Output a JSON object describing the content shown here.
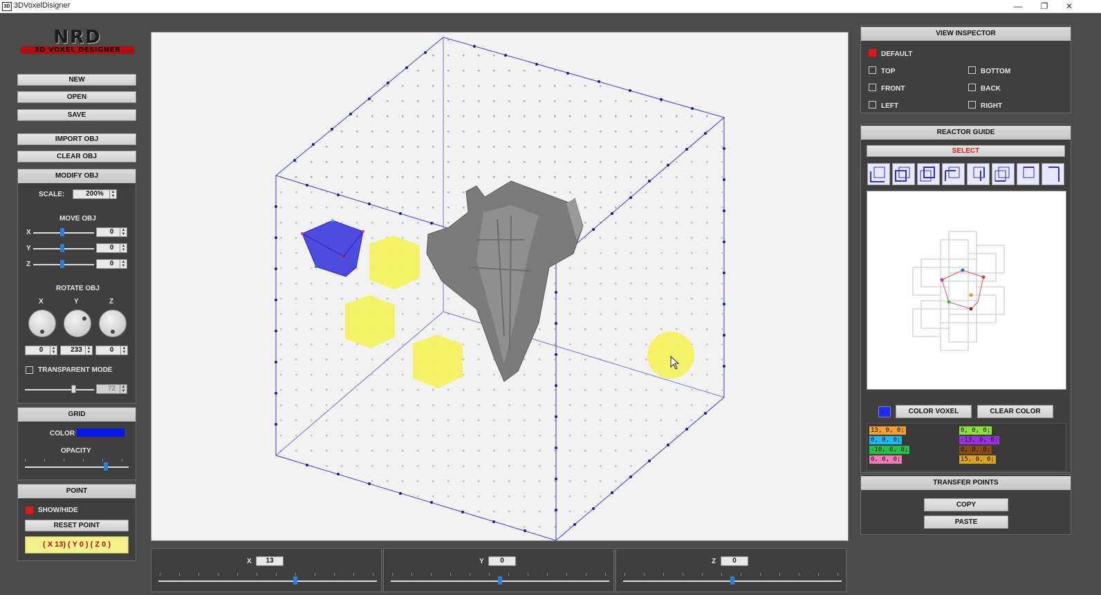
{
  "window": {
    "title": "3DVoxelDisigner",
    "minimize": "—",
    "restore": "❐",
    "close": "✕",
    "app_icon": "3D"
  },
  "logo": {
    "line1": "NRD",
    "line2": "3D VOXEL DESIGNER"
  },
  "file": {
    "new": "NEW",
    "open": "OPEN",
    "save": "SAVE"
  },
  "obj": {
    "import": "IMPORT OBJ",
    "clear": "CLEAR OBJ",
    "modify": "MODIFY OBJ",
    "scale_label": "SCALE:",
    "scale_value": "200%",
    "move_label": "MOVE OBJ",
    "move": [
      {
        "axis": "X",
        "value": "0"
      },
      {
        "axis": "Y",
        "value": "0"
      },
      {
        "axis": "Z",
        "value": "0"
      }
    ],
    "rotate_label": "ROTATE OBJ",
    "rotate": [
      {
        "axis": "X",
        "value": "0"
      },
      {
        "axis": "Y",
        "value": "233"
      },
      {
        "axis": "Z",
        "value": "0"
      }
    ],
    "transparent_label": "TRANSPARENT MODE",
    "transparent_value": "72"
  },
  "grid": {
    "header": "GRID",
    "color_label": "COLOR",
    "color": "#0a18e6",
    "opacity_label": "OPACITY"
  },
  "point": {
    "header": "POINT",
    "show_hide": "SHOW/HIDE",
    "reset": "RESET POINT",
    "coord_x": "( X 13)",
    "coord_y": "( Y 0 )",
    "coord_z": "( Z 0 )"
  },
  "axes": [
    {
      "label": "X",
      "value": "13"
    },
    {
      "label": "Y",
      "value": "0"
    },
    {
      "label": "Z",
      "value": "0"
    }
  ],
  "view_inspector": {
    "header": "VIEW INSPECTOR",
    "default": "DEFAULT",
    "top": "TOP",
    "bottom": "BOTTOM",
    "front": "FRONT",
    "back": "BACK",
    "left": "LEFT",
    "right": "RIGHT"
  },
  "reactor": {
    "header": "REACTOR GUIDE",
    "select": "SELECT",
    "color_voxel": "COLOR VOXEL",
    "clear_color": "CLEAR COLOR",
    "swatch": "#1a2cff",
    "coords_left": [
      {
        "text": "13, 0, 0;",
        "bg": "#f0a030"
      },
      {
        "text": "0, 0, 0;",
        "bg": "#20b8f0"
      },
      {
        "text": "-10, 0, 0;",
        "bg": "#26c046"
      },
      {
        "text": "0, 0, 0;",
        "bg": "#f07ab8"
      }
    ],
    "coords_right": [
      {
        "text": "0, 0, 0;",
        "bg": "#8ce03c"
      },
      {
        "text": "-13, 0, 0;",
        "bg": "#9b30e0"
      },
      {
        "text": "0, 0, 0;",
        "bg": "#8a4a16"
      },
      {
        "text": "15, 0, 0;",
        "bg": "#e0a020"
      }
    ]
  },
  "transfer": {
    "header": "TRANSFER POINTS",
    "copy": "COPY",
    "paste": "PASTE"
  }
}
